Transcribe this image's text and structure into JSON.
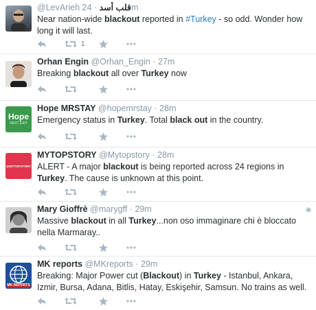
{
  "colors": {
    "link": "#2b7bb9",
    "muted": "#8899a6",
    "icon": "#aab8c2",
    "border": "#e1e8ed"
  },
  "tweets": [
    {
      "name": "",
      "handle": "@LevArieh",
      "handle_suffix": "قلب أسد",
      "time": "24m",
      "segments": [
        {
          "t": "Near nation-wide "
        },
        {
          "t": "blackout",
          "b": true
        },
        {
          "t": " reported in "
        },
        {
          "t": "#Turkey",
          "h": true
        },
        {
          "t": " - so odd. Wonder how long it will last."
        }
      ],
      "retweet_count": "1",
      "avatar_icon": "avatar-photo-icon"
    },
    {
      "name": "Orhan Engin",
      "handle": "@Orhan_Engin",
      "time": "27m",
      "segments": [
        {
          "t": "Breaking "
        },
        {
          "t": "blackout",
          "b": true
        },
        {
          "t": " all over "
        },
        {
          "t": "Turkey",
          "b": true
        },
        {
          "t": " now"
        }
      ],
      "avatar_icon": "avatar-photo-icon"
    },
    {
      "name": "Hope MRSTAY",
      "handle": "@hopemrstay",
      "time": "28m",
      "segments": [
        {
          "t": "Emergency status in "
        },
        {
          "t": "Turkey",
          "b": true
        },
        {
          "t": ". Total "
        },
        {
          "t": "black out",
          "b": true
        },
        {
          "t": " in the country."
        }
      ],
      "avatar_text": "Hope",
      "avatar_sub": "NEXT EXIT"
    },
    {
      "name": "MYTOPSTORY",
      "handle": "@Mytopstory",
      "time": "28m",
      "segments": [
        {
          "t": "ALERT - A major "
        },
        {
          "t": "blackout",
          "b": true
        },
        {
          "t": " is being reported across 24 regions in "
        },
        {
          "t": "Turkey",
          "b": true
        },
        {
          "t": ". The cause is unknown at this point."
        }
      ],
      "avatar_text": "@MYTOPSTORY"
    },
    {
      "name": "Mary Gioffrè",
      "handle": "@marygff",
      "time": "29m",
      "segments": [
        {
          "t": "Massive "
        },
        {
          "t": "blackout",
          "b": true
        },
        {
          "t": " in all "
        },
        {
          "t": "Turkey",
          "b": true
        },
        {
          "t": "...non oso immaginare chi è bloccato nella Marmaray.."
        }
      ],
      "avatar_icon": "avatar-photo-icon"
    },
    {
      "name": "MK reports",
      "handle": "@MKreports",
      "time": "29m",
      "segments": [
        {
          "t": "Breaking: Major Power cut ("
        },
        {
          "t": "Blackout",
          "b": true
        },
        {
          "t": ") in "
        },
        {
          "t": "Turkey",
          "b": true
        },
        {
          "t": " - Istanbul, Ankara, Izmir, Bursa, Adana, Bitlis, Hatay, Eskişehir, Samsun. No trains as well."
        }
      ],
      "avatar_text": "MK REPORTS"
    }
  ]
}
